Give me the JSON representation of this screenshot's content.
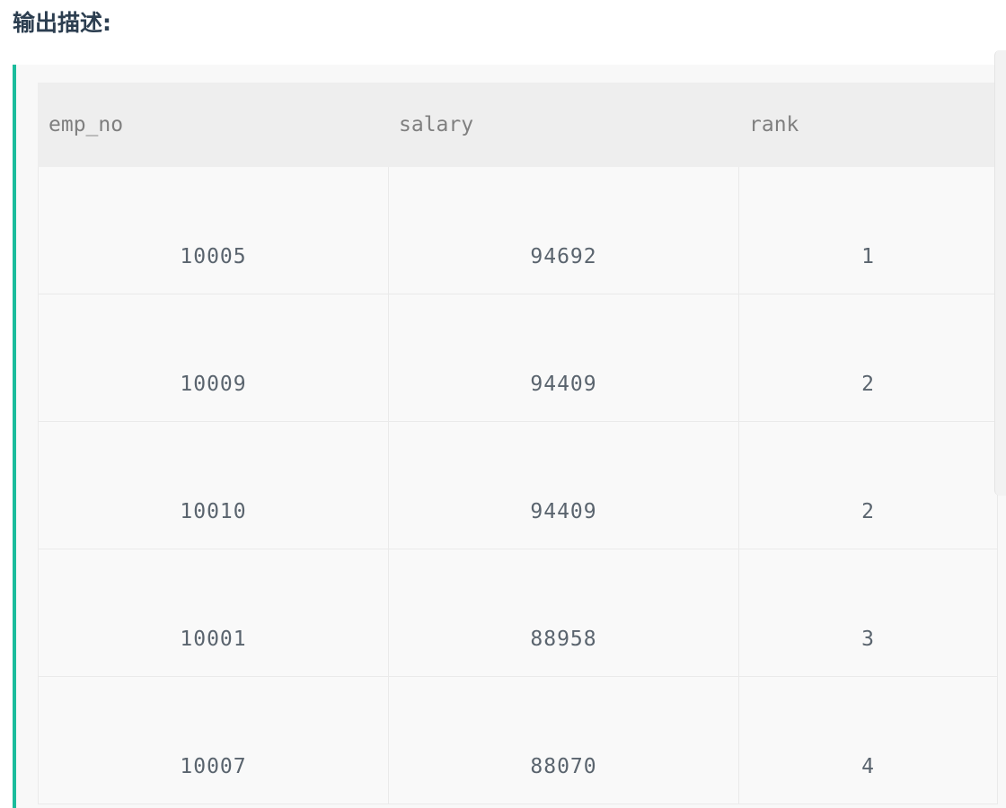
{
  "heading": "输出描述:",
  "table": {
    "headers": [
      "emp_no",
      "salary",
      "rank"
    ],
    "rows": [
      [
        "10005",
        "94692",
        "1"
      ],
      [
        "10009",
        "94409",
        "2"
      ],
      [
        "10010",
        "94409",
        "2"
      ],
      [
        "10001",
        "88958",
        "3"
      ],
      [
        "10007",
        "88070",
        "4"
      ]
    ]
  },
  "colors": {
    "accent_border": "#1abc9c",
    "heading_text": "#2c3e50",
    "header_bg": "#eeeeee",
    "cell_bg": "#f9f9f9"
  }
}
